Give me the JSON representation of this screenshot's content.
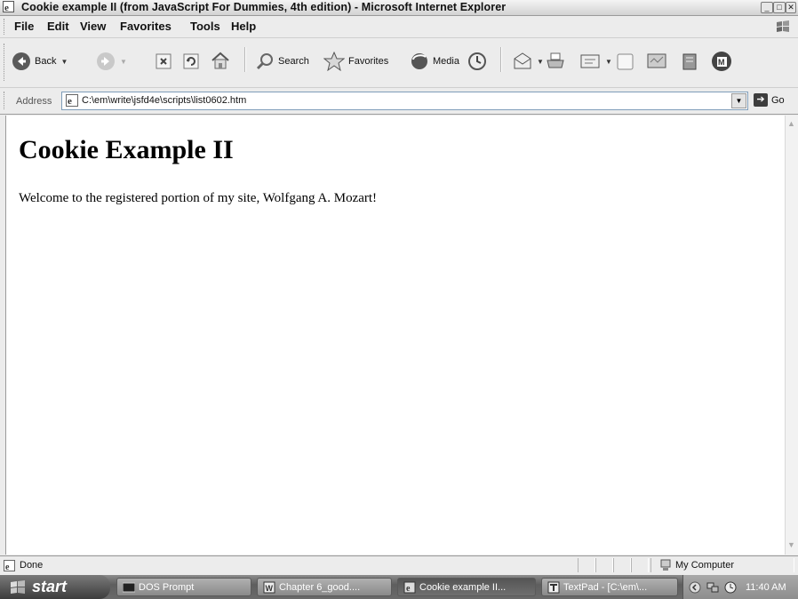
{
  "window": {
    "title": "Cookie example II (from JavaScript For Dummies, 4th edition) - Microsoft Internet Explorer",
    "controls": {
      "minimize": "_",
      "maximize": "□",
      "close": "✕"
    }
  },
  "menu": [
    "File",
    "Edit",
    "View",
    "Favorites",
    "Tools",
    "Help"
  ],
  "toolbar": {
    "back": "Back",
    "search": "Search",
    "favorites": "Favorites",
    "media": "Media"
  },
  "address": {
    "label": "Address",
    "url": "C:\\em\\write\\jsfd4e\\scripts\\list0602.htm",
    "go": "Go"
  },
  "page": {
    "heading": "Cookie Example II",
    "text": "Welcome to the registered portion of my site, Wolfgang A. Mozart!"
  },
  "status": {
    "text": "Done",
    "zone": "My Computer"
  },
  "taskbar": {
    "start": "start",
    "tasks": [
      "DOS Prompt",
      "Chapter 6_good....",
      "Cookie example II...",
      "TextPad - [C:\\em\\..."
    ],
    "clock": "11:40 AM"
  },
  "colors": {
    "page_background": "#ffffff",
    "chrome": "#ececec",
    "taskbar": "#6a6a6a"
  }
}
